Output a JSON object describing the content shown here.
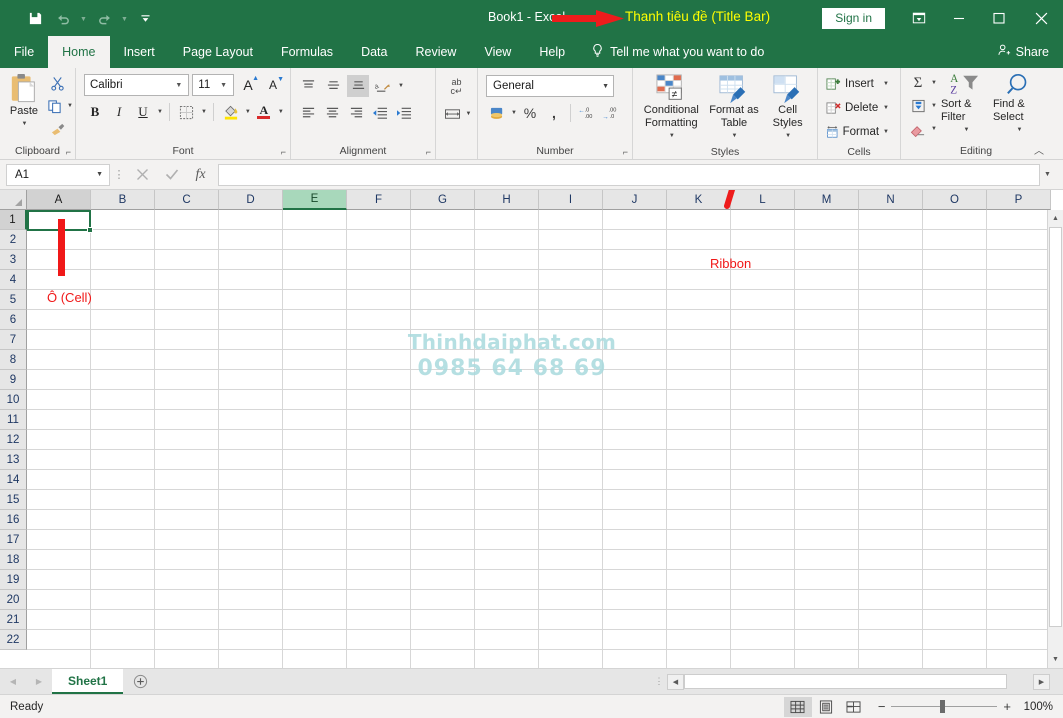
{
  "titlebar": {
    "quick_access": [
      {
        "name": "save-icon",
        "label": "Save"
      },
      {
        "name": "undo-icon",
        "label": "Undo"
      },
      {
        "name": "redo-icon",
        "label": "Redo"
      },
      {
        "name": "customize-qat-icon",
        "label": "Customize Quick Access Toolbar"
      }
    ],
    "document_title": "Book1  -  Excel",
    "annotation": "Thanh tiêu đề (Title Bar)",
    "sign_in": "Sign in",
    "ribbon_display_options": "ribbon-display-options-icon",
    "minimize": "minimize-icon",
    "maximize": "maximize-icon",
    "close": "close-icon"
  },
  "tabs": [
    {
      "label": "File",
      "active": false
    },
    {
      "label": "Home",
      "active": true
    },
    {
      "label": "Insert",
      "active": false
    },
    {
      "label": "Page Layout",
      "active": false
    },
    {
      "label": "Formulas",
      "active": false
    },
    {
      "label": "Data",
      "active": false
    },
    {
      "label": "Review",
      "active": false
    },
    {
      "label": "View",
      "active": false
    },
    {
      "label": "Help",
      "active": false
    }
  ],
  "tell_me": "Tell me what you want to do",
  "share": "Share",
  "ribbon": {
    "clipboard": {
      "label": "Clipboard",
      "paste": "Paste",
      "cut": "cut-icon",
      "copy": "copy-icon",
      "format_painter": "format-painter-icon"
    },
    "font": {
      "label": "Font",
      "font_name": "Calibri",
      "font_size": "11",
      "grow_font": "A",
      "shrink_font": "A",
      "bold": "B",
      "italic": "I",
      "underline": "U",
      "borders": "borders-icon",
      "fill_color": "fill-color-icon",
      "font_color": "A"
    },
    "alignment": {
      "label": "Alignment",
      "top_align": "top-align-icon",
      "middle_align": "middle-align-icon",
      "bottom_align": "bottom-align-icon",
      "orientation": "orientation-icon",
      "align_left": "align-left-icon",
      "center": "align-center-icon",
      "align_right": "align-right-icon",
      "decrease_indent": "decrease-indent-icon",
      "increase_indent": "increase-indent-icon",
      "wrap_text": "wrap-text-icon",
      "merge_center": "merge-center-icon"
    },
    "number": {
      "label": "Number",
      "format": "General",
      "accounting": "accounting-format-icon",
      "percent": "%",
      "comma": ",",
      "increase_decimal": "increase-decimal-icon",
      "decrease_decimal": "decrease-decimal-icon"
    },
    "styles": {
      "label": "Styles",
      "conditional_formatting": "Conditional Formatting",
      "format_as_table": "Format as Table",
      "cell_styles": "Cell Styles"
    },
    "cells": {
      "label": "Cells",
      "insert": "Insert",
      "delete": "Delete",
      "format": "Format"
    },
    "editing": {
      "label": "Editing",
      "autosum": "autosum-icon",
      "fill": "fill-icon",
      "clear": "clear-icon",
      "sort_filter": "Sort & Filter",
      "find_select": "Find & Select"
    },
    "annotation": "Ribbon"
  },
  "formula_bar": {
    "name_box": "A1",
    "cancel": "cancel-icon",
    "enter": "enter-icon",
    "insert_function": "fx",
    "formula_value": ""
  },
  "grid": {
    "columns": [
      "A",
      "B",
      "C",
      "D",
      "E",
      "F",
      "G",
      "H",
      "I",
      "J",
      "K",
      "L",
      "M",
      "N",
      "O",
      "P"
    ],
    "selected_column": "E",
    "active_column": "A",
    "rows": [
      1,
      2,
      3,
      4,
      5,
      6,
      7,
      8,
      9,
      10,
      11,
      12,
      13,
      14,
      15,
      16,
      17,
      18,
      19,
      20,
      21,
      22
    ],
    "active_row": 1,
    "selected_cell": "A1",
    "cell_annotation": "Ô (Cell)",
    "watermark_line1": "Thinhdaiphat.com",
    "watermark_line2": "0985 64 68 69"
  },
  "sheet_tabs": {
    "prev": "prev-sheet-icon",
    "next": "next-sheet-icon",
    "sheets": [
      "Sheet1"
    ],
    "add_sheet": "add-sheet-icon"
  },
  "status_bar": {
    "status": "Ready",
    "view_normal": "normal-view-icon",
    "view_page_layout": "page-layout-view-icon",
    "view_page_break": "page-break-view-icon",
    "zoom_out": "−",
    "zoom_in": "+",
    "zoom_level": "100%"
  },
  "colors": {
    "excel_green": "#217346",
    "annotation_red": "#f01818",
    "annotation_yellow": "#ffff00",
    "watermark": "#a9dadd"
  }
}
